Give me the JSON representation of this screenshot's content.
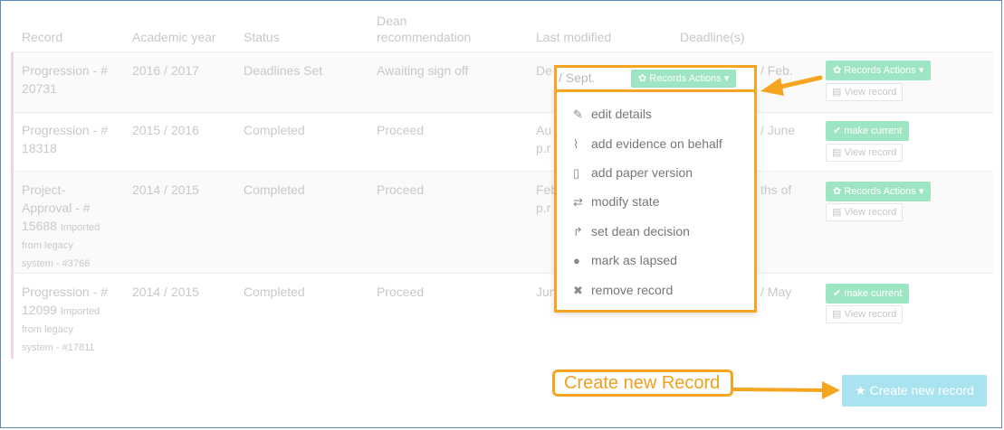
{
  "headers": {
    "record": "Record",
    "academic_year": "Academic year",
    "status": "Status",
    "dean_line1": "Dean",
    "dean_line2": "recommendation",
    "last_modified": "Last modified",
    "deadlines": "Deadline(s)"
  },
  "rows": [
    {
      "record_line1": "Progression - #",
      "record_line2": "20731",
      "year": "2016 / 2017",
      "status": "Deadlines Set",
      "dean": "Awaiting sign off",
      "modified_frag": "De",
      "deadline_frag": "/ Feb.",
      "action": "Records Actions",
      "view": "View record"
    },
    {
      "record_line1": "Progression - #",
      "record_line2": "18318",
      "year": "2015 / 2016",
      "status": "Completed",
      "dean": "Proceed",
      "modified_frag1": "Au",
      "modified_frag2": "p.r",
      "deadline_frag": "/ June",
      "action": "make current",
      "view": "View record"
    },
    {
      "record_line1": "Project-",
      "record_line2": "Approval - #",
      "record_line3": "15688",
      "imported": "Imported",
      "record_line4": "from legacy",
      "record_line5": "system - #3766",
      "year": "2014 / 2015",
      "status": "Completed",
      "dean": "Proceed",
      "modified_frag1": "Feb",
      "modified_frag2": "p.r",
      "deadline_frag": "ths of",
      "action": "Records Actions",
      "view": "View record"
    },
    {
      "record_line1": "Progression - #",
      "record_line2": "12099",
      "imported": "Imported",
      "record_line3": "from legacy",
      "record_line4": "system - #17811",
      "year": "2014 / 2015",
      "status": "Completed",
      "dean": "Proceed",
      "modified_frag": "Jun",
      "deadline_frag": "/ May",
      "action": "make current",
      "view": "View record"
    }
  ],
  "dropdown": {
    "top_text": "/ Sept.",
    "button": "Records Actions",
    "items": [
      {
        "icon": "pencil-icon",
        "label": "edit details"
      },
      {
        "icon": "paperclip-icon",
        "label": "add evidence on behalf"
      },
      {
        "icon": "file-icon",
        "label": "add paper version"
      },
      {
        "icon": "exchange-icon",
        "label": "modify state"
      },
      {
        "icon": "share-icon",
        "label": "set dean decision"
      },
      {
        "icon": "exclamation-circle-icon",
        "label": "mark as lapsed"
      },
      {
        "icon": "times-icon",
        "label": "remove record"
      }
    ]
  },
  "callout": "Create new Record",
  "create_button": "Create new record",
  "colors": {
    "annotation": "#f5a51f",
    "green_button": "#9ee6c3",
    "create_button": "#a8e3ef"
  }
}
